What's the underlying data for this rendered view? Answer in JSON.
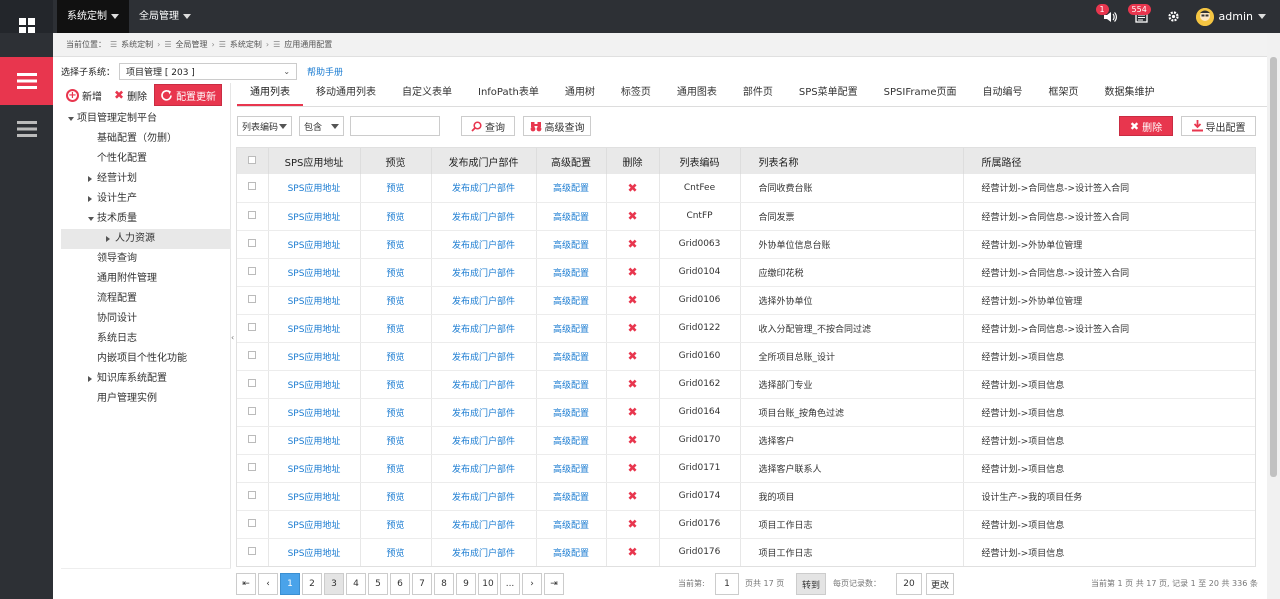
{
  "topnav": {
    "items": [
      {
        "label": "系统定制",
        "active": true
      },
      {
        "label": "全局管理",
        "active": false
      }
    ]
  },
  "topright": {
    "sound_badge": "1",
    "message_badge": "554",
    "username": "admin"
  },
  "breadcrumb": {
    "prefix": "当前位置：",
    "items": [
      "系统定制",
      "全局管理",
      "系统定制",
      "应用通用配置"
    ]
  },
  "subsystem": {
    "label": "选择子系统：",
    "value": "项目管理 [ 203 ]",
    "help": "帮助手册"
  },
  "toolbar": {
    "add": "新增",
    "delete": "删除",
    "update": "配置更新"
  },
  "tree": [
    {
      "label": "项目管理定制平台",
      "level": 0,
      "arrow": "down"
    },
    {
      "label": "基础配置（勿删）",
      "level": 1,
      "arrow": ""
    },
    {
      "label": "个性化配置",
      "level": 1,
      "arrow": ""
    },
    {
      "label": "经营计划",
      "level": 1,
      "arrow": "right"
    },
    {
      "label": "设计生产",
      "level": 1,
      "arrow": "right"
    },
    {
      "label": "技术质量",
      "level": 1,
      "arrow": "down"
    },
    {
      "label": "人力资源",
      "level": 2,
      "arrow": "right",
      "selected": true
    },
    {
      "label": "领导查询",
      "level": 1,
      "arrow": ""
    },
    {
      "label": "通用附件管理",
      "level": 1,
      "arrow": ""
    },
    {
      "label": "流程配置",
      "level": 1,
      "arrow": ""
    },
    {
      "label": "协同设计",
      "level": 1,
      "arrow": ""
    },
    {
      "label": "系统日志",
      "level": 1,
      "arrow": ""
    },
    {
      "label": "内嵌项目个性化功能",
      "level": 1,
      "arrow": ""
    },
    {
      "label": "知识库系统配置",
      "level": 1,
      "arrow": "right"
    },
    {
      "label": "用户管理实例",
      "level": 1,
      "arrow": ""
    }
  ],
  "tabs": [
    "通用列表",
    "移动通用列表",
    "自定义表单",
    "InfoPath表单",
    "通用树",
    "标签页",
    "通用图表",
    "部件页",
    "SPS菜单配置",
    "SPSIFrame页面",
    "自动编号",
    "框架页",
    "数据集维护"
  ],
  "filter": {
    "field": "列表编码",
    "op": "包含",
    "query": "查询",
    "advanced": "高级查询",
    "delete": "删除",
    "export": "导出配置"
  },
  "grid": {
    "headers": [
      "SPS应用地址",
      "预览",
      "发布成门户部件",
      "高级配置",
      "删除",
      "列表编码",
      "列表名称",
      "所属路径"
    ],
    "link_sps": "SPS应用地址",
    "link_preview": "预览",
    "link_publish": "发布成门户部件",
    "link_advanced": "高级配置",
    "delete_mark": "✖",
    "rows": [
      {
        "code": "CntFee",
        "name": "合同收费台账",
        "path": "经营计划->合同信息->设计签入合同"
      },
      {
        "code": "CntFP",
        "name": "合同发票",
        "path": "经营计划->合同信息->设计签入合同"
      },
      {
        "code": "Grid0063",
        "name": "外协单位信息台账",
        "path": "经营计划->外协单位管理"
      },
      {
        "code": "Grid0104",
        "name": "应缴印花税",
        "path": "经营计划->合同信息->设计签入合同"
      },
      {
        "code": "Grid0106",
        "name": "选择外协单位",
        "path": "经营计划->外协单位管理"
      },
      {
        "code": "Grid0122",
        "name": "收入分配管理_不按合同过滤",
        "path": "经营计划->合同信息->设计签入合同"
      },
      {
        "code": "Grid0160",
        "name": "全所项目总账_设计",
        "path": "经营计划->项目信息"
      },
      {
        "code": "Grid0162",
        "name": "选择部门专业",
        "path": "经营计划->项目信息"
      },
      {
        "code": "Grid0164",
        "name": "项目台账_按角色过滤",
        "path": "经营计划->项目信息"
      },
      {
        "code": "Grid0170",
        "name": "选择客户",
        "path": "经营计划->项目信息"
      },
      {
        "code": "Grid0171",
        "name": "选择客户联系人",
        "path": "经营计划->项目信息"
      },
      {
        "code": "Grid0174",
        "name": "我的项目",
        "path": "设计生产->我的项目任务"
      },
      {
        "code": "Grid0176",
        "name": "项目工作日志",
        "path": "经营计划->项目信息"
      },
      {
        "code": "Grid0176",
        "name": "项目工作日志",
        "path": "经营计划->项目信息"
      }
    ]
  },
  "pager": {
    "pages": [
      "1",
      "2",
      "3",
      "4",
      "5",
      "6",
      "7",
      "8",
      "9",
      "10",
      "..."
    ],
    "current_label": "当前第:",
    "current_value": "1",
    "total_pages": "页共 17 页",
    "goto": "转到",
    "per_page_label": "每页记录数：",
    "per_page_value": "20",
    "change": "更改",
    "summary": "当前第 1 页 共 17 页, 记录 1 至 20 共 336 条"
  },
  "colors": {
    "accent": "#e8364e",
    "link": "#1a7bd1",
    "topbar": "#2d3035"
  }
}
